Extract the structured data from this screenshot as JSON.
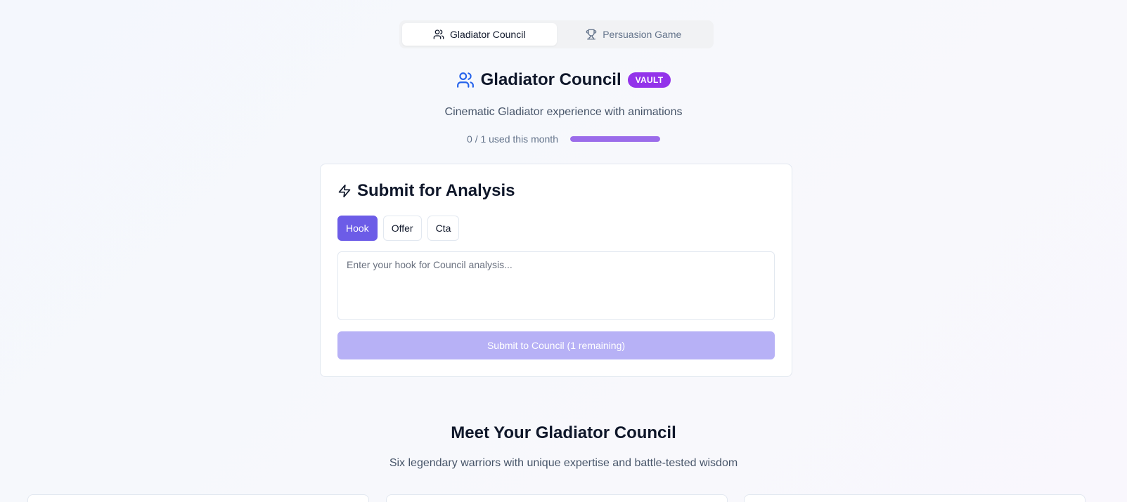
{
  "tabs": [
    {
      "label": "Gladiator Council",
      "icon": "users-icon",
      "active": true
    },
    {
      "label": "Persuasion Game",
      "icon": "trophy-icon",
      "active": false
    }
  ],
  "header": {
    "title": "Gladiator Council",
    "badge": "VAULT",
    "subtitle": "Cinematic Gladiator experience with animations"
  },
  "usage": {
    "text": "0 / 1 used this month",
    "used": 0,
    "limit": 1,
    "bar_fraction": 1.0
  },
  "analysis": {
    "title": "Submit for Analysis",
    "types": [
      {
        "label": "Hook",
        "active": true
      },
      {
        "label": "Offer",
        "active": false
      },
      {
        "label": "Cta",
        "active": false
      }
    ],
    "input_value": "",
    "input_placeholder": "Enter your hook for Council analysis...",
    "submit_label": "Submit to Council (1 remaining)"
  },
  "council": {
    "title": "Meet Your Gladiator Council",
    "subtitle": "Six legendary warriors with unique expertise and battle-tested wisdom"
  },
  "colors": {
    "accent": "#6c5ce7",
    "badge": "#9333ea",
    "usage_fill": "#9b6cea",
    "icon_blue": "#2563eb"
  }
}
